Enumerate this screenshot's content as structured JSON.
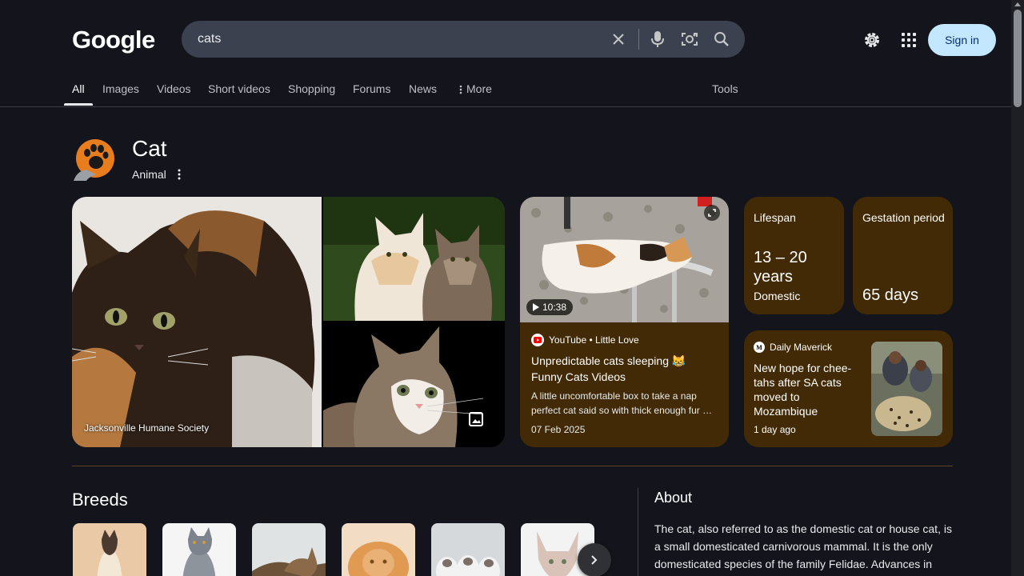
{
  "header": {
    "logo": "Google",
    "search_value": "cats",
    "sign_in": "Sign in"
  },
  "tabs": [
    {
      "label": "All"
    },
    {
      "label": "Images"
    },
    {
      "label": "Videos"
    },
    {
      "label": "Short videos"
    },
    {
      "label": "Shopping"
    },
    {
      "label": "Forums"
    },
    {
      "label": "News"
    },
    {
      "label": "More"
    }
  ],
  "tools_label": "Tools",
  "entity": {
    "title": "Cat",
    "subtitle": "Animal"
  },
  "images": {
    "credit": "Jacksonville Humane Society"
  },
  "video": {
    "duration": "10:38",
    "source": "YouTube • Little Love",
    "title": "Unpredictable cats sleeping 😹 Funny Cats Videos",
    "description": "A little uncomfortable box to take a nap perfect cat said so with thick enough fur …",
    "date": "07 Feb 2025"
  },
  "facts": [
    {
      "label": "Lifespan",
      "value": "13 – 20 years",
      "note": "Domestic"
    },
    {
      "label": "Gestation period",
      "value": "65 days",
      "note": ""
    }
  ],
  "news": {
    "source": "Daily Maverick",
    "title": "New hope for chee-tahs after SA cats moved to Mozambique",
    "time": "1 day ago"
  },
  "breeds": {
    "title": "Breeds"
  },
  "about": {
    "title": "About",
    "text": "The cat, also referred to as the domestic cat or house cat, is a small domesticated carnivorous mammal. It is the only domesticated species of the family Felidae. Advances in"
  },
  "colors": {
    "card_bg": "#422a07",
    "page_bg": "#14151c",
    "signin_bg": "#c2e7ff"
  }
}
